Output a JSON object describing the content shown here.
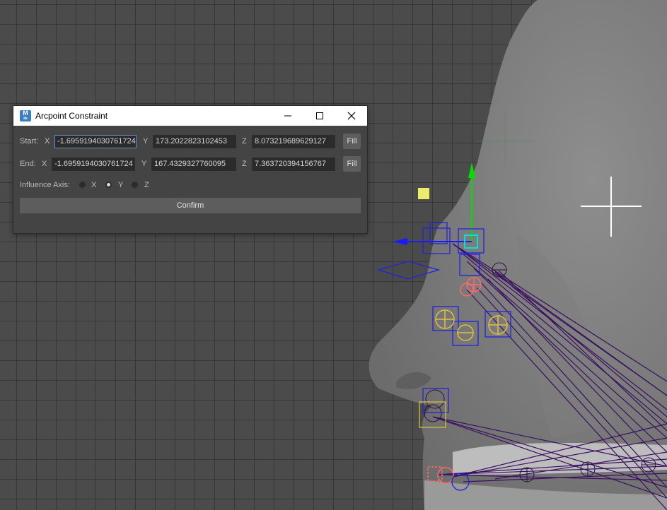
{
  "window": {
    "title": "Arcpoint Constraint",
    "icon_letter": "M",
    "icon_sub": "kk",
    "minimize_icon": "minimize-icon",
    "maximize_icon": "maximize-icon",
    "close_icon": "close-icon"
  },
  "start": {
    "label": "Start:",
    "x_label": "X",
    "x_value": "-1.6959194030761724",
    "y_label": "Y",
    "y_value": "173.2022823102453",
    "z_label": "Z",
    "z_value": "8.073219689629127",
    "fill_label": "Fill"
  },
  "end": {
    "label": "End:",
    "x_label": "X",
    "x_value": "-1.6959194030761724",
    "y_label": "Y",
    "y_value": "167.4329327760095",
    "z_label": "Z",
    "z_value": "7.363720394156767",
    "fill_label": "Fill"
  },
  "influence": {
    "label": "Influence Axis:",
    "options": [
      "X",
      "Y",
      "Z"
    ],
    "selected": "Y"
  },
  "confirm_label": "Confirm",
  "colors": {
    "viewport_bg": "#4b4b4b",
    "dialog_bg": "#444444",
    "field_bg": "#2b2b2b",
    "active_border": "#5e8fce",
    "joint_yellow": "#e0c040",
    "control_blue": "#2222dd",
    "influence_lines": "#3a1060"
  }
}
